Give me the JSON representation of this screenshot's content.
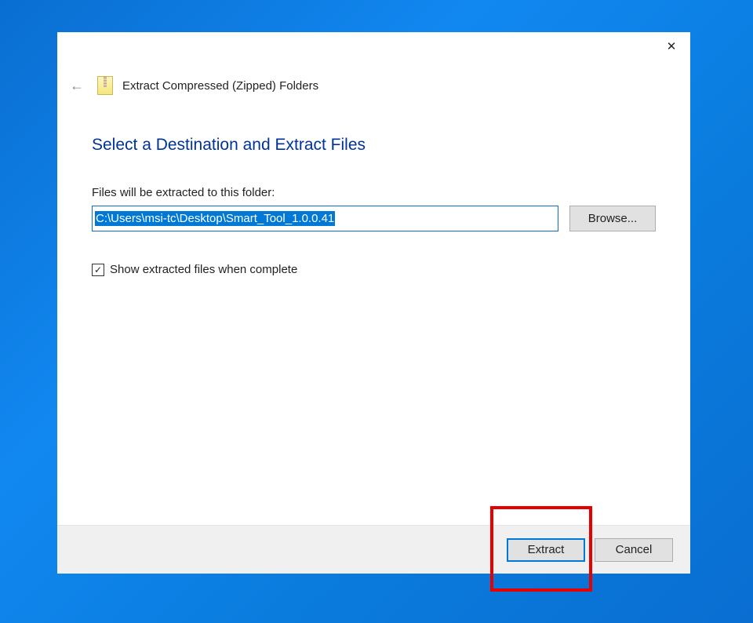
{
  "header": {
    "title": "Extract Compressed (Zipped) Folders"
  },
  "content": {
    "heading": "Select a Destination and Extract Files",
    "folder_label": "Files will be extracted to this folder:",
    "path_value": "C:\\Users\\msi-tc\\Desktop\\Smart_Tool_1.0.0.41",
    "browse_label": "Browse...",
    "checkbox_label": "Show extracted files when complete",
    "checkbox_checked": true
  },
  "footer": {
    "extract_label": "Extract",
    "cancel_label": "Cancel"
  }
}
